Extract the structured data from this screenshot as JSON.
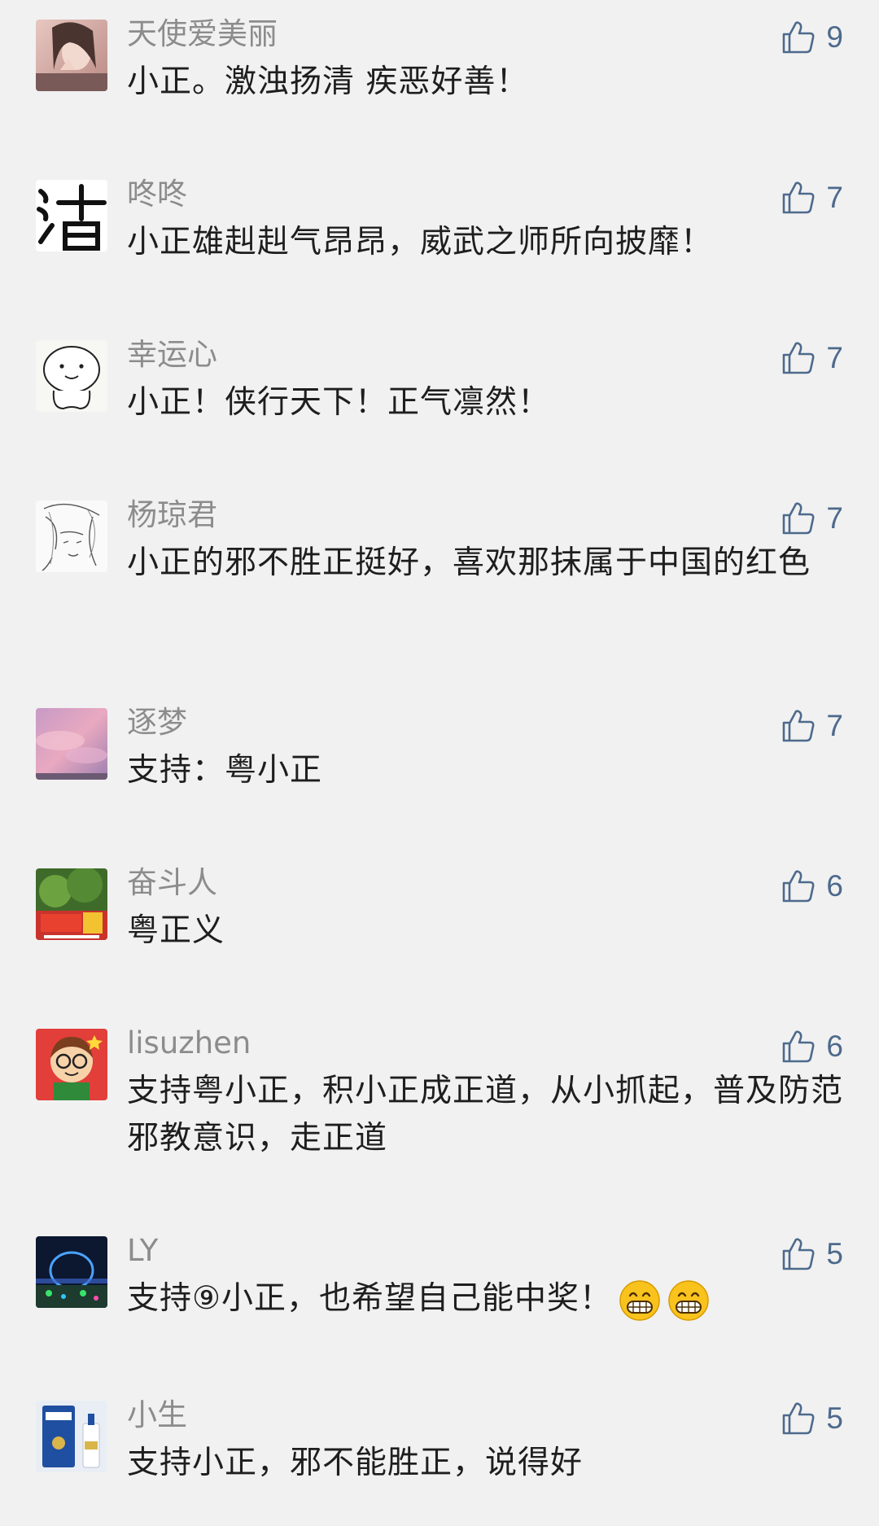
{
  "colors": {
    "background": "#f1f1f1",
    "nickname": "#8c8c8c",
    "content": "#1e1e1e",
    "like": "#4d6a8c"
  },
  "comments": [
    {
      "nickname": "天使爱美丽",
      "content": "小正。激浊扬清 疾恶好善！",
      "likes": "9",
      "avatar_icon": "portrait-photo-icon"
    },
    {
      "nickname": "咚咚",
      "content": "小正雄赳赳气昂昂，威武之师所向披靡！",
      "likes": "7",
      "avatar_icon": "calligraphy-icon"
    },
    {
      "nickname": "幸运心",
      "content": "小正！侠行天下！正气凛然！",
      "likes": "7",
      "avatar_icon": "cartoon-face-icon"
    },
    {
      "nickname": "杨琼君",
      "content": "小正的邪不胜正挺好，喜欢那抹属于中国的红色",
      "likes": "7",
      "avatar_icon": "anime-sketch-icon"
    },
    {
      "nickname": "逐梦",
      "content": "支持：粤小正",
      "likes": "7",
      "avatar_icon": "pink-sky-icon"
    },
    {
      "nickname": "奋斗人",
      "content": "粤正义",
      "likes": "6",
      "avatar_icon": "national-day-icon"
    },
    {
      "nickname": "lisuzhen",
      "content": "支持粤小正，积小正成正道，从小抓起，普及防范邪教意识，走正道",
      "likes": "6",
      "avatar_icon": "cartoon-boy-icon"
    },
    {
      "nickname": "LY",
      "content": "支持⑨小正，也希望自己能中奖！",
      "likes": "5",
      "avatar_icon": "night-stage-icon",
      "emoji": "grin-emoji-icon"
    },
    {
      "nickname": "小生",
      "content": "支持小正，邪不能胜正，说得好",
      "likes": "5",
      "avatar_icon": "liquor-bottle-icon"
    }
  ]
}
